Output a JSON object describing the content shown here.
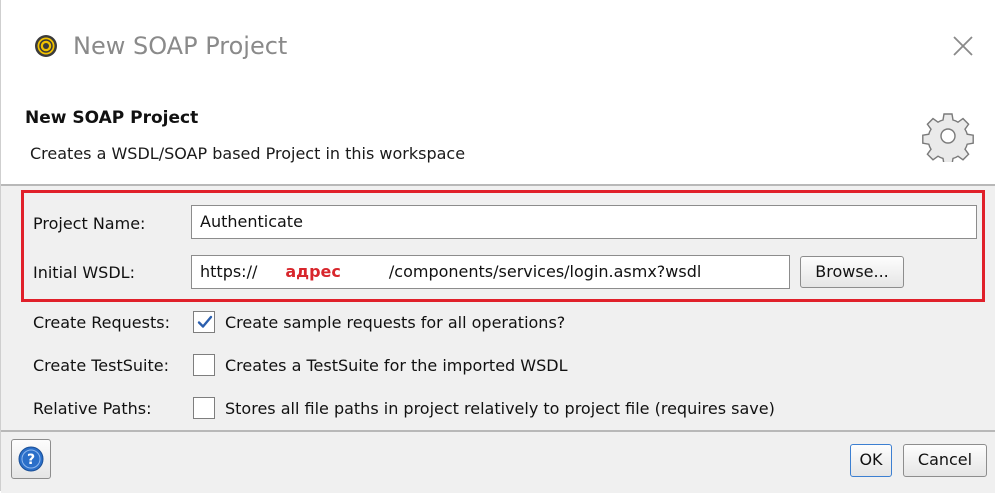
{
  "window": {
    "title": "New SOAP Project",
    "app_icon": "soapui-logo-icon",
    "close_icon": "close-icon"
  },
  "header": {
    "title": "New SOAP Project",
    "description": "Creates a WSDL/SOAP based Project in this workspace",
    "icon": "gear-icon"
  },
  "form": {
    "project_name": {
      "label": "Project Name:",
      "value": "Authenticate"
    },
    "initial_wsdl": {
      "label": "Initial WSDL:",
      "value_prefix": "https://",
      "value_address": "адрес",
      "value_suffix": "/components/services/login.asmx?wsdl",
      "browse_label": "Browse..."
    },
    "create_requests": {
      "label": "Create Requests:",
      "checked": true,
      "text": "Create sample requests for all operations?"
    },
    "create_testsuite": {
      "label": "Create TestSuite:",
      "checked": false,
      "text": "Creates a TestSuite for the imported WSDL"
    },
    "relative_paths": {
      "label": "Relative Paths:",
      "checked": false,
      "text": "Stores all file paths in project relatively to project file (requires save)"
    }
  },
  "footer": {
    "help_icon": "help-icon",
    "ok_label": "OK",
    "cancel_label": "Cancel"
  },
  "colors": {
    "highlight": "#e0202a",
    "address_text": "#d8262c",
    "help_blue": "#2a6fc9"
  }
}
